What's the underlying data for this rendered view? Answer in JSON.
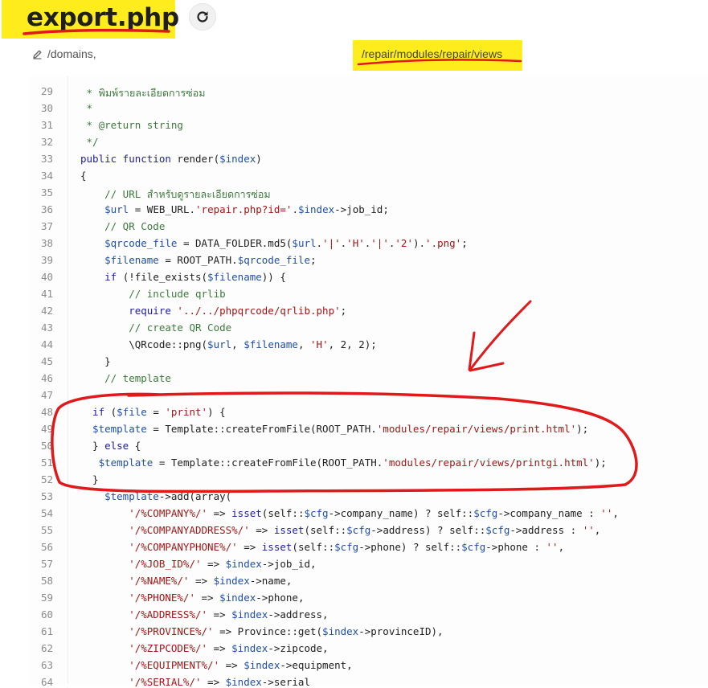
{
  "header": {
    "title": "export.php",
    "path_start": "/domains,",
    "path_end": "/repair/modules/repair/views",
    "edit_icon": "pencil-icon",
    "refresh_icon": "refresh-icon"
  },
  "code": {
    "first_line_number": 29,
    "lines": [
      [
        [
          "cm",
          " * พิมพ์รายละเอียดการซ่อม"
        ]
      ],
      [
        [
          "cm",
          " *"
        ]
      ],
      [
        [
          "cm",
          " * @return string"
        ]
      ],
      [
        [
          "cm",
          " */"
        ]
      ],
      [
        [
          "kw",
          "public function "
        ],
        [
          "pl",
          "render("
        ],
        [
          "var",
          "$index"
        ],
        [
          "pl",
          ")"
        ]
      ],
      [
        [
          "pl",
          "{"
        ]
      ],
      [
        [
          "cm",
          "    // URL สำหรับดูรายละเอียดการซ่อม"
        ]
      ],
      [
        [
          "var",
          "    $url"
        ],
        [
          "pl",
          " = WEB_URL."
        ],
        [
          "str",
          "'repair.php?id='"
        ],
        [
          "pl",
          "."
        ],
        [
          "var",
          "$index"
        ],
        [
          "pl",
          "->job_id;"
        ]
      ],
      [
        [
          "cm",
          "    // QR Code"
        ]
      ],
      [
        [
          "var",
          "    $qrcode_file"
        ],
        [
          "pl",
          " = DATA_FOLDER.md5("
        ],
        [
          "var",
          "$url"
        ],
        [
          "pl",
          "."
        ],
        [
          "str",
          "'|'"
        ],
        [
          "pl",
          "."
        ],
        [
          "str",
          "'H'"
        ],
        [
          "pl",
          "."
        ],
        [
          "str",
          "'|'"
        ],
        [
          "pl",
          "."
        ],
        [
          "str",
          "'2'"
        ],
        [
          "pl",
          ")."
        ],
        [
          "str",
          "'.png'"
        ],
        [
          "pl",
          ";"
        ]
      ],
      [
        [
          "var",
          "    $filename"
        ],
        [
          "pl",
          " = ROOT_PATH."
        ],
        [
          "var",
          "$qrcode_file"
        ],
        [
          "pl",
          ";"
        ]
      ],
      [
        [
          "kw",
          "    if "
        ],
        [
          "pl",
          "(!file_exists("
        ],
        [
          "var",
          "$filename"
        ],
        [
          "pl",
          ")) {"
        ]
      ],
      [
        [
          "cm",
          "        // include qrlib"
        ]
      ],
      [
        [
          "kw",
          "        require "
        ],
        [
          "str",
          "'../../phpqrcode/qrlib.php'"
        ],
        [
          "pl",
          ";"
        ]
      ],
      [
        [
          "cm",
          "        // create QR Code"
        ]
      ],
      [
        [
          "pl",
          "        \\QRcode::png("
        ],
        [
          "var",
          "$url"
        ],
        [
          "pl",
          ", "
        ],
        [
          "var",
          "$filename"
        ],
        [
          "pl",
          ", "
        ],
        [
          "str",
          "'H'"
        ],
        [
          "pl",
          ", 2, 2);"
        ]
      ],
      [
        [
          "pl",
          "    }"
        ]
      ],
      [
        [
          "cm",
          "    // template"
        ]
      ],
      [
        [
          "pl",
          ""
        ]
      ],
      [
        [
          "kw",
          "  if "
        ],
        [
          "pl",
          "("
        ],
        [
          "var",
          "$file"
        ],
        [
          "pl",
          " = "
        ],
        [
          "str",
          "'print'"
        ],
        [
          "pl",
          ") {"
        ]
      ],
      [
        [
          "var",
          "  $template"
        ],
        [
          "pl",
          " = Template::createFromFile(ROOT_PATH."
        ],
        [
          "str",
          "'modules/repair/views/print.html'"
        ],
        [
          "pl",
          ");"
        ]
      ],
      [
        [
          "pl",
          "  } "
        ],
        [
          "kw",
          "else "
        ],
        [
          "pl",
          "{"
        ]
      ],
      [
        [
          "var",
          "   $template"
        ],
        [
          "pl",
          " = Template::createFromFile(ROOT_PATH."
        ],
        [
          "str",
          "'modules/repair/views/printgi.html'"
        ],
        [
          "pl",
          ");"
        ]
      ],
      [
        [
          "pl",
          "  }"
        ]
      ],
      [
        [
          "var",
          "    $template"
        ],
        [
          "pl",
          "->add(array("
        ]
      ],
      [
        [
          "str",
          "        '/%COMPANY%/'"
        ],
        [
          "pl",
          " => "
        ],
        [
          "kw",
          "isset"
        ],
        [
          "pl",
          "(self::"
        ],
        [
          "var",
          "$cfg"
        ],
        [
          "pl",
          "->company_name) ? self::"
        ],
        [
          "var",
          "$cfg"
        ],
        [
          "pl",
          "->company_name : "
        ],
        [
          "str",
          "''"
        ],
        [
          "pl",
          ","
        ]
      ],
      [
        [
          "str",
          "        '/%COMPANYADDRESS%/'"
        ],
        [
          "pl",
          " => "
        ],
        [
          "kw",
          "isset"
        ],
        [
          "pl",
          "(self::"
        ],
        [
          "var",
          "$cfg"
        ],
        [
          "pl",
          "->address) ? self::"
        ],
        [
          "var",
          "$cfg"
        ],
        [
          "pl",
          "->address : "
        ],
        [
          "str",
          "''"
        ],
        [
          "pl",
          ","
        ]
      ],
      [
        [
          "str",
          "        '/%COMPANYPHONE%/'"
        ],
        [
          "pl",
          " => "
        ],
        [
          "kw",
          "isset"
        ],
        [
          "pl",
          "(self::"
        ],
        [
          "var",
          "$cfg"
        ],
        [
          "pl",
          "->phone) ? self::"
        ],
        [
          "var",
          "$cfg"
        ],
        [
          "pl",
          "->phone : "
        ],
        [
          "str",
          "''"
        ],
        [
          "pl",
          ","
        ]
      ],
      [
        [
          "str",
          "        '/%JOB_ID%/'"
        ],
        [
          "pl",
          " => "
        ],
        [
          "var",
          "$index"
        ],
        [
          "pl",
          "->job_id,"
        ]
      ],
      [
        [
          "str",
          "        '/%NAME%/'"
        ],
        [
          "pl",
          " => "
        ],
        [
          "var",
          "$index"
        ],
        [
          "pl",
          "->name,"
        ]
      ],
      [
        [
          "str",
          "        '/%PHONE%/'"
        ],
        [
          "pl",
          " => "
        ],
        [
          "var",
          "$index"
        ],
        [
          "pl",
          "->phone,"
        ]
      ],
      [
        [
          "str",
          "        '/%ADDRESS%/'"
        ],
        [
          "pl",
          " => "
        ],
        [
          "var",
          "$index"
        ],
        [
          "pl",
          "->address,"
        ]
      ],
      [
        [
          "str",
          "        '/%PROVINCE%/'"
        ],
        [
          "pl",
          " => Province::get("
        ],
        [
          "var",
          "$index"
        ],
        [
          "pl",
          "->provinceID),"
        ]
      ],
      [
        [
          "str",
          "        '/%ZIPCODE%/'"
        ],
        [
          "pl",
          " => "
        ],
        [
          "var",
          "$index"
        ],
        [
          "pl",
          "->zipcode,"
        ]
      ],
      [
        [
          "str",
          "        '/%EQUIPMENT%/'"
        ],
        [
          "pl",
          " => "
        ],
        [
          "var",
          "$index"
        ],
        [
          "pl",
          "->equipment,"
        ]
      ],
      [
        [
          "str",
          "        '/%SERIAL%/'"
        ],
        [
          "pl",
          " => "
        ],
        [
          "var",
          "$index"
        ],
        [
          "pl",
          "->serial"
        ]
      ]
    ]
  },
  "colors": {
    "highlight": "#ffec1c",
    "ink": "#e0191b",
    "comment": "#3c7a3c",
    "keyword": "#2020a0",
    "string": "#a31515",
    "variable": "#1f4fa8"
  }
}
